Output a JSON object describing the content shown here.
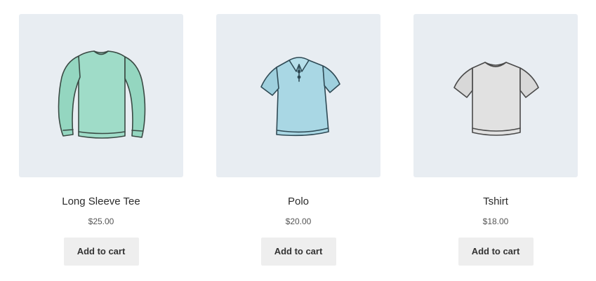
{
  "products": [
    {
      "name": "Long Sleeve Tee",
      "price": "$25.00",
      "button": "Add to cart",
      "image": "long-sleeve-tee-icon",
      "color": "#9fdcc8"
    },
    {
      "name": "Polo",
      "price": "$20.00",
      "button": "Add to cart",
      "image": "polo-shirt-icon",
      "color": "#a9d7e4"
    },
    {
      "name": "Tshirt",
      "price": "$18.00",
      "button": "Add to cart",
      "image": "tshirt-icon",
      "color": "#e1e1e1"
    }
  ]
}
